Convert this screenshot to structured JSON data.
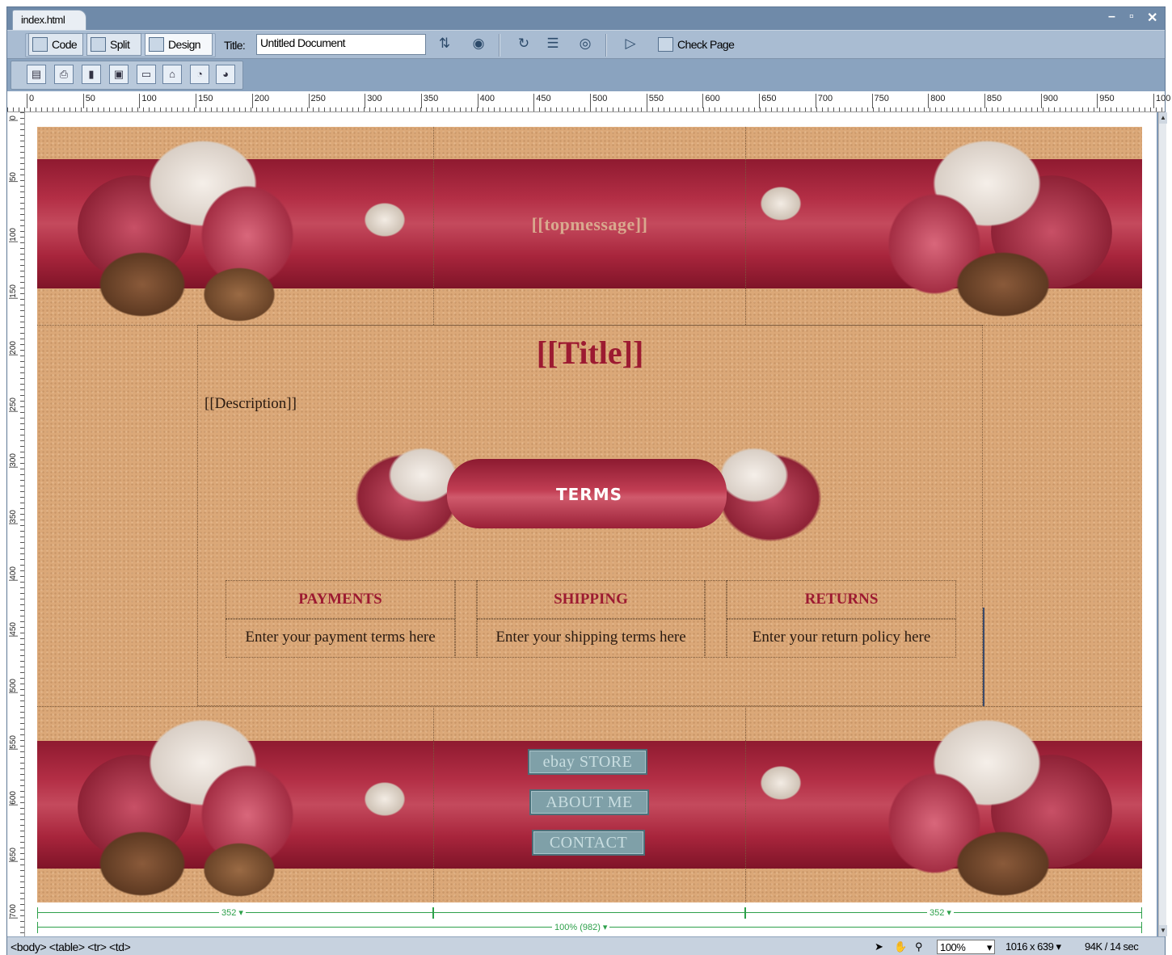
{
  "window": {
    "doc_tab": "index.html",
    "controls": {
      "minimize": "–",
      "restore": "▫",
      "close": "✕"
    }
  },
  "toolbar": {
    "code_label": "Code",
    "split_label": "Split",
    "design_label": "Design",
    "title_label": "Title:",
    "title_value": "Untitled Document",
    "check_page_label": "Check Page",
    "active_view": "Design"
  },
  "ruler": {
    "h_labels": [
      "0",
      "50",
      "100",
      "150",
      "200",
      "250",
      "300",
      "350",
      "400",
      "450",
      "500",
      "550",
      "600",
      "650",
      "700",
      "750",
      "800",
      "850",
      "900",
      "950",
      "100"
    ],
    "v_labels": [
      "0",
      "50",
      "100",
      "150",
      "200",
      "250",
      "300",
      "350",
      "400",
      "450",
      "500",
      "550",
      "600",
      "650",
      "700"
    ]
  },
  "page": {
    "topmessage": "[[topmessage]]",
    "title": "[[Title]]",
    "description": "[[Description]]",
    "terms_banner": "TERMS",
    "terms": {
      "headers": [
        "PAYMENTS",
        "SHIPPING",
        "RETURNS"
      ],
      "cells": [
        "Enter your payment terms here",
        "Enter your shipping terms here",
        "Enter your return policy here"
      ]
    },
    "nav": [
      "ebay STORE",
      "ABOUT ME",
      "CONTACT"
    ]
  },
  "measurements": {
    "left_col": "352 ▾",
    "right_col": "352 ▾",
    "table": "100% (982) ▾"
  },
  "statusbar": {
    "tag_selector": "<body> <table> <tr> <td>",
    "zoom": "100%",
    "window_size": "1016 x 639 ▾",
    "download": "94K / 14 sec"
  },
  "colors": {
    "band_red": "#a8253c",
    "accent_title": "#9c1a31",
    "page_tan": "#dba878",
    "nav_button": "#7fa0a8",
    "measure_green": "#2da04a"
  }
}
